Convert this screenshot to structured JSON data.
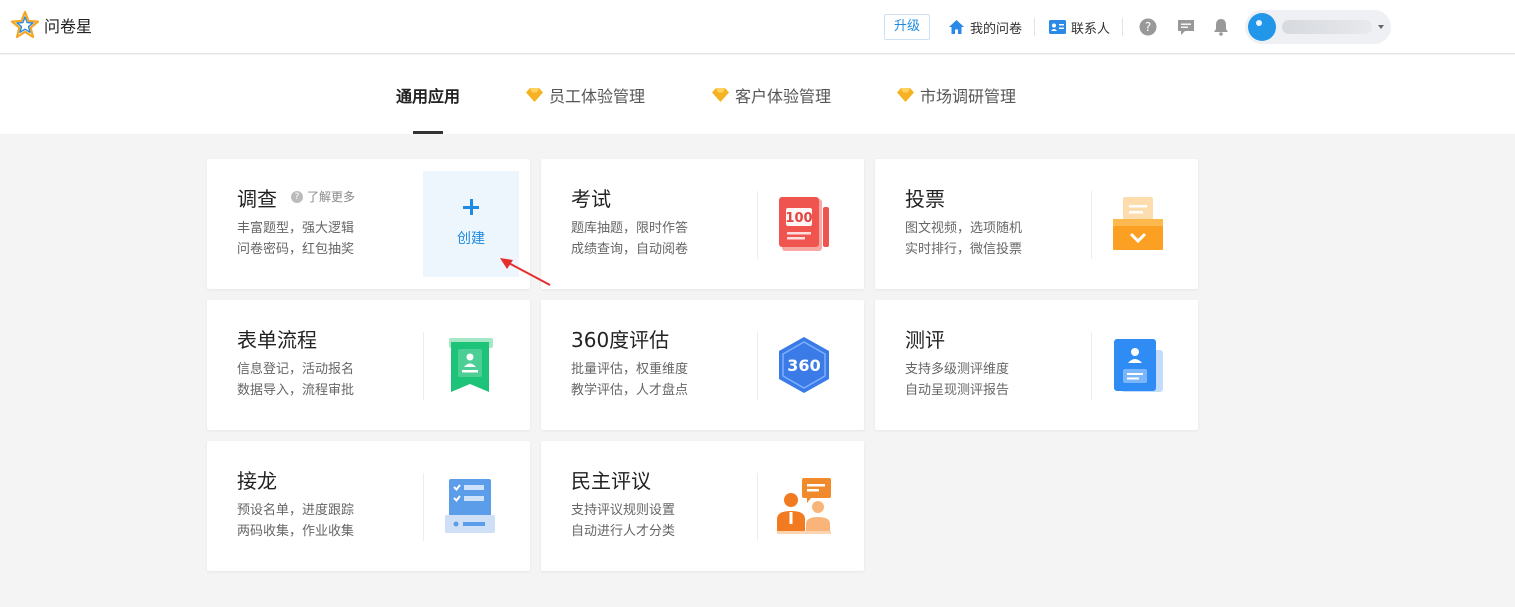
{
  "header": {
    "logo_text": "问卷星",
    "upgrade_label": "升级",
    "my_surveys_label": "我的问卷",
    "contacts_label": "联系人"
  },
  "tabs": [
    {
      "label": "通用应用",
      "active": true
    },
    {
      "label": "员工体验管理",
      "active": false
    },
    {
      "label": "客户体验管理",
      "active": false
    },
    {
      "label": "市场调研管理",
      "active": false
    }
  ],
  "cards": {
    "survey": {
      "title": "调查",
      "learn_more": "了解更多",
      "line1": "丰富题型，强大逻辑",
      "line2": "问卷密码，红包抽奖",
      "create_label": "创建"
    },
    "exam": {
      "title": "考试",
      "line1": "题库抽题，限时作答",
      "line2": "成绩查询，自动阅卷",
      "icon_text": "100"
    },
    "vote": {
      "title": "投票",
      "line1": "图文视频，选项随机",
      "line2": "实时排行，微信投票"
    },
    "form": {
      "title": "表单流程",
      "line1": "信息登记，活动报名",
      "line2": "数据导入，流程审批"
    },
    "eval360": {
      "title": "360度评估",
      "line1": "批量评估，权重维度",
      "line2": "教学评估，人才盘点",
      "icon_text": "360"
    },
    "assessment": {
      "title": "测评",
      "line1": "支持多级测评维度",
      "line2": "自动呈现测评报告"
    },
    "relay": {
      "title": "接龙",
      "line1": "预设名单，进度跟踪",
      "line2": "两码收集，作业收集"
    },
    "democratic": {
      "title": "民主评议",
      "line1": "支持评议规则设置",
      "line2": "自动进行人才分类"
    }
  },
  "colors": {
    "accent": "#1f8be0",
    "gem": "#f5b323",
    "exam_red": "#f0544f",
    "vote_orange": "#fba023",
    "form_green": "#1ec37a",
    "eval_blue": "#3a7be8",
    "assess_blue": "#2f8cf5"
  },
  "icons": [
    "star-logo-icon",
    "home-icon",
    "contact-card-icon",
    "help-icon",
    "message-icon",
    "bell-icon",
    "gem-icon",
    "plus-icon"
  ]
}
